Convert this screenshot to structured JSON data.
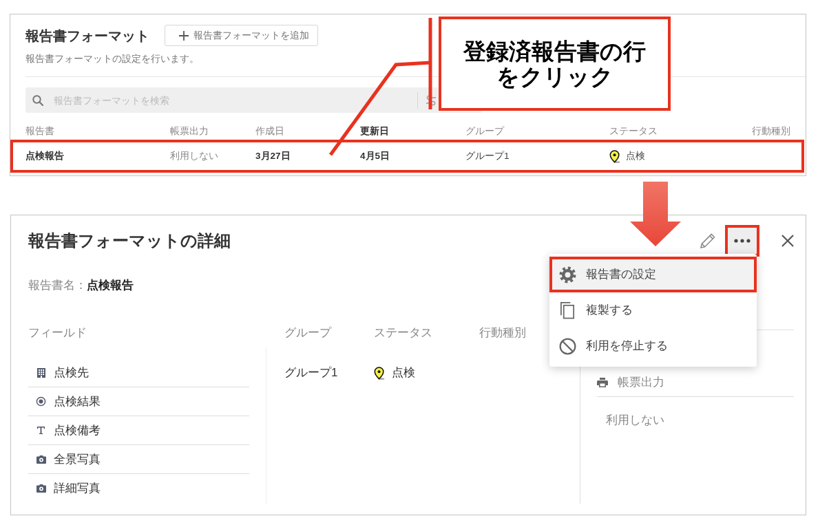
{
  "format_list": {
    "title": "報告書フォーマット",
    "add_button": {
      "label": "報告書フォーマットを追加"
    },
    "description": "報告書フォーマットの設定を行います。",
    "search": {
      "placeholder": "報告書フォーマットを検索"
    },
    "table": {
      "columns": [
        {
          "label": "報告書",
          "sorted": false
        },
        {
          "label": "帳票出力",
          "sorted": false
        },
        {
          "label": "作成日",
          "sorted": false
        },
        {
          "label": "更新日",
          "sorted": true
        },
        {
          "label": "グループ",
          "sorted": false
        },
        {
          "label": "ステータス",
          "sorted": false
        },
        {
          "label": "行動種別",
          "sorted": false
        }
      ],
      "rows": [
        {
          "highlighted": true,
          "cells": [
            {
              "kind": "text",
              "text": "点検報告"
            },
            {
              "kind": "text",
              "text": "利用しない"
            },
            {
              "kind": "text",
              "text": "3月27日"
            },
            {
              "kind": "text",
              "text": "4月5日"
            },
            {
              "kind": "text",
              "text": "グループ1"
            },
            {
              "kind": "status",
              "text": "点検",
              "color": "#f4f04a"
            }
          ]
        }
      ]
    }
  },
  "callout": {
    "text": "登録済報告書の行をクリック"
  },
  "detail": {
    "title": "報告書フォーマットの詳細",
    "more_button": {
      "highlighted": true
    },
    "report_name": {
      "label": "報告書名：",
      "value": "点検報告"
    },
    "fields_heading": "フィールド",
    "fields": [
      {
        "kind": "place",
        "label": "点検先"
      },
      {
        "kind": "choice",
        "label": "点検結果"
      },
      {
        "kind": "text",
        "label": "点検備考"
      },
      {
        "kind": "photo",
        "label": "全景写真"
      },
      {
        "kind": "photo",
        "label": "詳細写真"
      }
    ],
    "attributes": {
      "columns": [
        {
          "label": "グループ"
        },
        {
          "label": "ステータス"
        },
        {
          "label": "行動種別"
        }
      ],
      "values": [
        {
          "kind": "text",
          "text": "グループ1"
        },
        {
          "kind": "status",
          "text": "点検",
          "color": "#f4f04a"
        }
      ]
    },
    "form_output": {
      "label": "帳票出力",
      "value": "利用しない"
    },
    "menu": {
      "items": [
        {
          "kind": "settings",
          "label": "報告書の設定",
          "highlighted": true
        },
        {
          "kind": "duplicate",
          "label": "複製する",
          "highlighted": false
        },
        {
          "kind": "disable",
          "label": "利用を停止する",
          "highlighted": false
        }
      ]
    }
  }
}
